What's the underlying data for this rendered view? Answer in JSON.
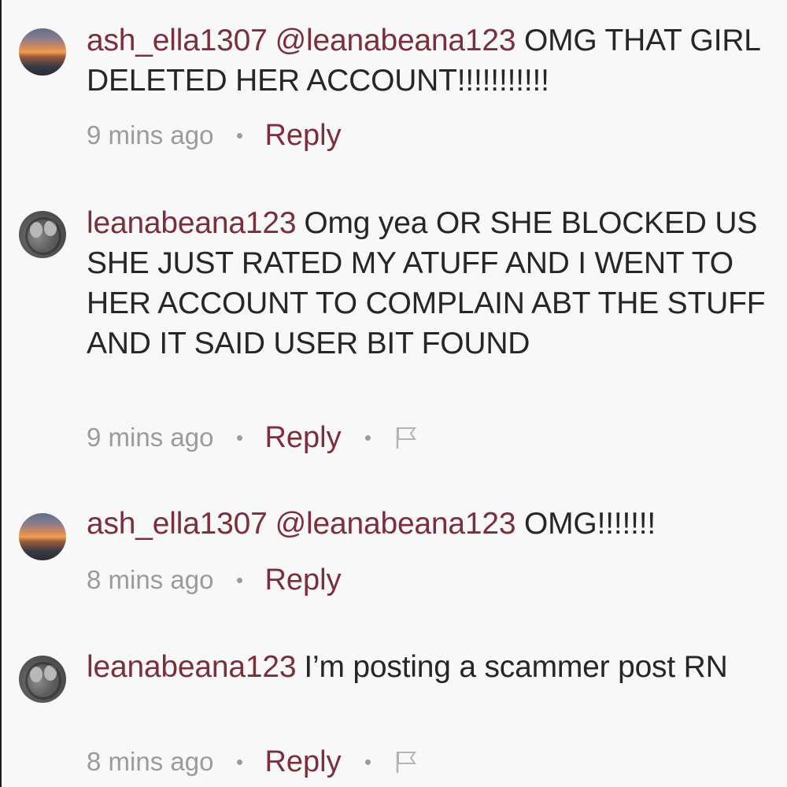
{
  "comments": [
    {
      "username": "ash_ella1307",
      "mention": "@leanabeana123",
      "text": " OMG THAT GIRL DELETED HER ACCOUNT!!!!!!!!!!!",
      "time": "9 mins ago",
      "reply_label": "Reply",
      "avatar_icon": "sunset-avatar",
      "has_flag": false
    },
    {
      "username": "leanabeana123",
      "mention": "",
      "text": "Omg yea OR SHE BLOCKED US SHE JUST RATED MY ATUFF AND I WENT TO HER ACCOUNT TO COMPLAIN ABT THE STUFF AND IT SAID USER BIT FOUND",
      "time": "9 mins ago",
      "reply_label": "Reply",
      "avatar_icon": "photo-avatar",
      "has_flag": true
    },
    {
      "username": "ash_ella1307",
      "mention": "@leanabeana123",
      "text": " OMG!!!!!!!",
      "time": "8 mins ago",
      "reply_label": "Reply",
      "avatar_icon": "sunset-avatar",
      "has_flag": false
    },
    {
      "username": "leanabeana123",
      "mention": "",
      "text": "I’m posting a scammer post RN",
      "time": "8 mins ago",
      "reply_label": "Reply",
      "avatar_icon": "photo-avatar",
      "has_flag": true
    }
  ],
  "colors": {
    "username": "#7a2f3a",
    "text": "#262626",
    "meta": "#9b9b9b",
    "background": "#f9f8f8"
  }
}
